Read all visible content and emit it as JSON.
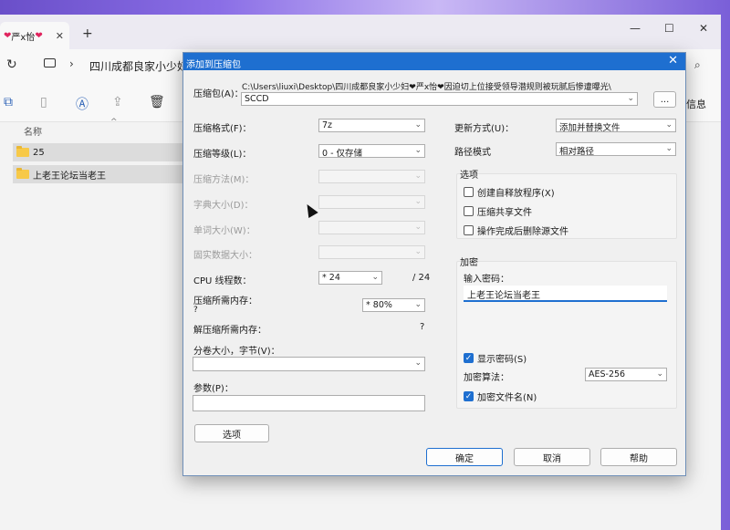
{
  "explorer": {
    "tab_title": "严x怡",
    "path_text": "四川成都良家小少妇",
    "toolbar_info": "信息",
    "column_name": "名称",
    "files": [
      "25",
      "上老王论坛当老王"
    ]
  },
  "dialog": {
    "title": "添加到压缩包",
    "archive_label": "压缩包(A)：",
    "archive_path": "C:\\Users\\liuxi\\Desktop\\四川成都良家小少妇❤严x怡❤因迫切上位接受领导潜规则被玩腻后惨遭曝光\\",
    "archive_name": "SCCD",
    "browse_button": "...",
    "format_label": "压缩格式(F)：",
    "format_value": "7z",
    "level_label": "压缩等级(L)：",
    "level_value": "0 - 仅存储",
    "method_label": "压缩方法(M)：",
    "dict_label": "字典大小(D)：",
    "word_label": "单词大小(W)：",
    "solid_label": "固实数据大小：",
    "cpu_label": "CPU 线程数：",
    "cpu_value": "* 24",
    "cpu_total": "/ 24",
    "mem_label": "压缩所需内存：",
    "mem_q": "?",
    "mem_value": "* 80%",
    "decomp_label": "解压缩所需内存：",
    "decomp_q": "?",
    "split_label": "分卷大小，字节(V)：",
    "params_label": "参数(P)：",
    "options_button": "选项",
    "update_label": "更新方式(U)：",
    "update_value": "添加并替换文件",
    "pathmode_label": "路径模式",
    "pathmode_value": "相对路径",
    "options_group": "选项",
    "opt_sfx": "创建自释放程序(X)",
    "opt_shared": "压缩共享文件",
    "opt_delete": "操作完成后删除源文件",
    "encrypt_group": "加密",
    "password_label": "输入密码：",
    "password_value": "上老王论坛当老王",
    "show_password": "显示密码(S)",
    "enc_method_label": "加密算法：",
    "enc_method_value": "AES-256",
    "enc_names": "加密文件名(N)",
    "ok_button": "确定",
    "cancel_button": "取消",
    "help_button": "帮助"
  },
  "icons": [
    "close-icon",
    "refresh-icon",
    "computer-icon",
    "chevron-right-icon",
    "search-icon",
    "copy-icon",
    "paste-icon",
    "rename-icon",
    "share-icon",
    "delete-icon",
    "folder-icon",
    "checkmark-icon",
    "dropdown-arrow-icon"
  ]
}
